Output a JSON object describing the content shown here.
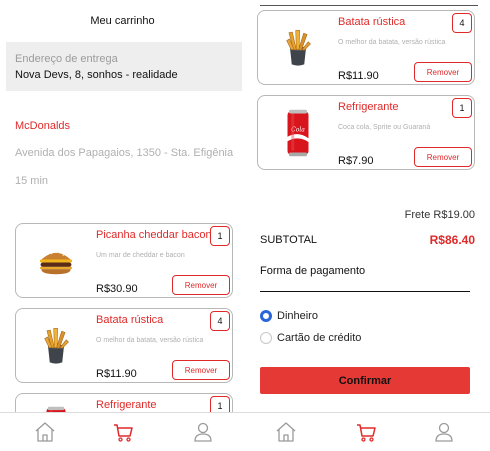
{
  "left": {
    "header_title": "Meu carrinho",
    "address": {
      "label": "Endereço de entrega",
      "value": "Nova Devs, 8, sonhos - realidade"
    },
    "restaurant": {
      "name": "McDonalds",
      "address": "Avenida dos Papagaios, 1350 - Sta. Efigênia",
      "time": "15 min"
    },
    "items": [
      {
        "name": "Picanha cheddar bacon",
        "description": "Um mar de cheddar e bacon",
        "price": "R$30.90",
        "qty": "1",
        "remove_label": "Remover",
        "image_icon": "burger-icon"
      },
      {
        "name": "Batata rústica",
        "description": "O melhor da batata, versão rústica",
        "price": "R$11.90",
        "qty": "4",
        "remove_label": "Remover",
        "image_icon": "fries-icon"
      },
      {
        "name": "Refrigerante",
        "qty": "1",
        "image_icon": "soda-can-icon"
      }
    ]
  },
  "right": {
    "items": [
      {
        "name": "Batata rústica",
        "description": "O melhor da batata, versão rústica",
        "price": "R$11.90",
        "qty": "4",
        "remove_label": "Remover",
        "image_icon": "fries-icon"
      },
      {
        "name": "Refrigerante",
        "description": "Coca cola, Sprite ou Guaraná",
        "price": "R$7.90",
        "qty": "1",
        "remove_label": "Remover",
        "image_icon": "soda-can-icon"
      }
    ],
    "freight": "Frete R$19.00",
    "subtotal": {
      "label": "SUBTOTAL",
      "value": "R$86.40"
    },
    "payment": {
      "title": "Forma de pagamento",
      "options": [
        {
          "label": "Dinheiro",
          "selected": true
        },
        {
          "label": "Cartão de crédito",
          "selected": false
        }
      ]
    },
    "confirm_label": "Confirmar"
  },
  "nav": {
    "icons": [
      "home-icon",
      "cart-icon",
      "profile-icon"
    ],
    "active": "cart-icon"
  },
  "colors": {
    "accent": "#e02a2a",
    "nav_active": "#e02a2a",
    "nav_inactive": "#9a9a9a",
    "radio_selected": "#2a66d8",
    "confirm_bg": "#e53936",
    "address_bg": "#eeeeee"
  }
}
